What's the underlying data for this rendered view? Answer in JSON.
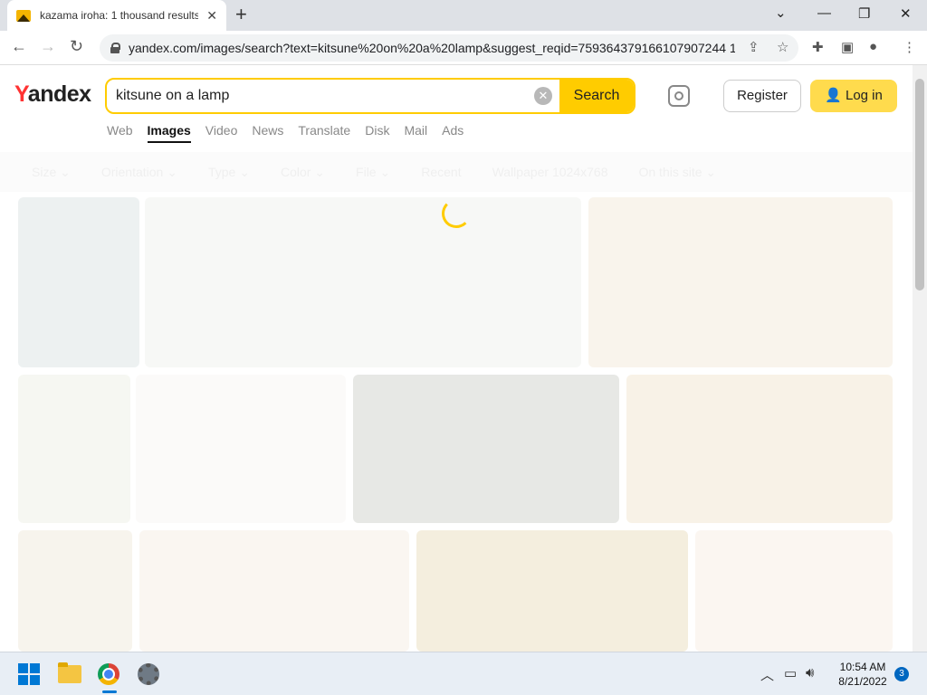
{
  "browser": {
    "tab_title": "kazama iroha: 1 thousand results",
    "tab_close": "✕",
    "new_tab": "+",
    "url": "yandex.com/images/search?text=kitsune%20on%20a%20lamp&suggest_reqid=759364379166107907244 1...",
    "window_controls": {
      "minimize": "—",
      "restore": "❐",
      "close": "✕",
      "tab_list": "⌄"
    }
  },
  "yandex": {
    "logo_first": "Y",
    "logo_rest": "andex",
    "search_query": "kitsune on a lamp",
    "search_button": "Search",
    "register_button": "Register",
    "login_button": "Log in",
    "nav": [
      "Web",
      "Images",
      "Video",
      "News",
      "Translate",
      "Disk",
      "Mail",
      "Ads"
    ],
    "active_nav": "Images",
    "filters": [
      "Size ⌄",
      "Orientation ⌄",
      "Type ⌄",
      "Color ⌄",
      "File ⌄",
      "Recent",
      "Wallpaper 1024x768",
      "On this site ⌄"
    ]
  },
  "taskbar": {
    "time": "10:54 AM",
    "date": "8/21/2022",
    "notification_count": "3"
  },
  "colors": {
    "accent": "#ffcc00",
    "brand_red": "#ff3333"
  }
}
